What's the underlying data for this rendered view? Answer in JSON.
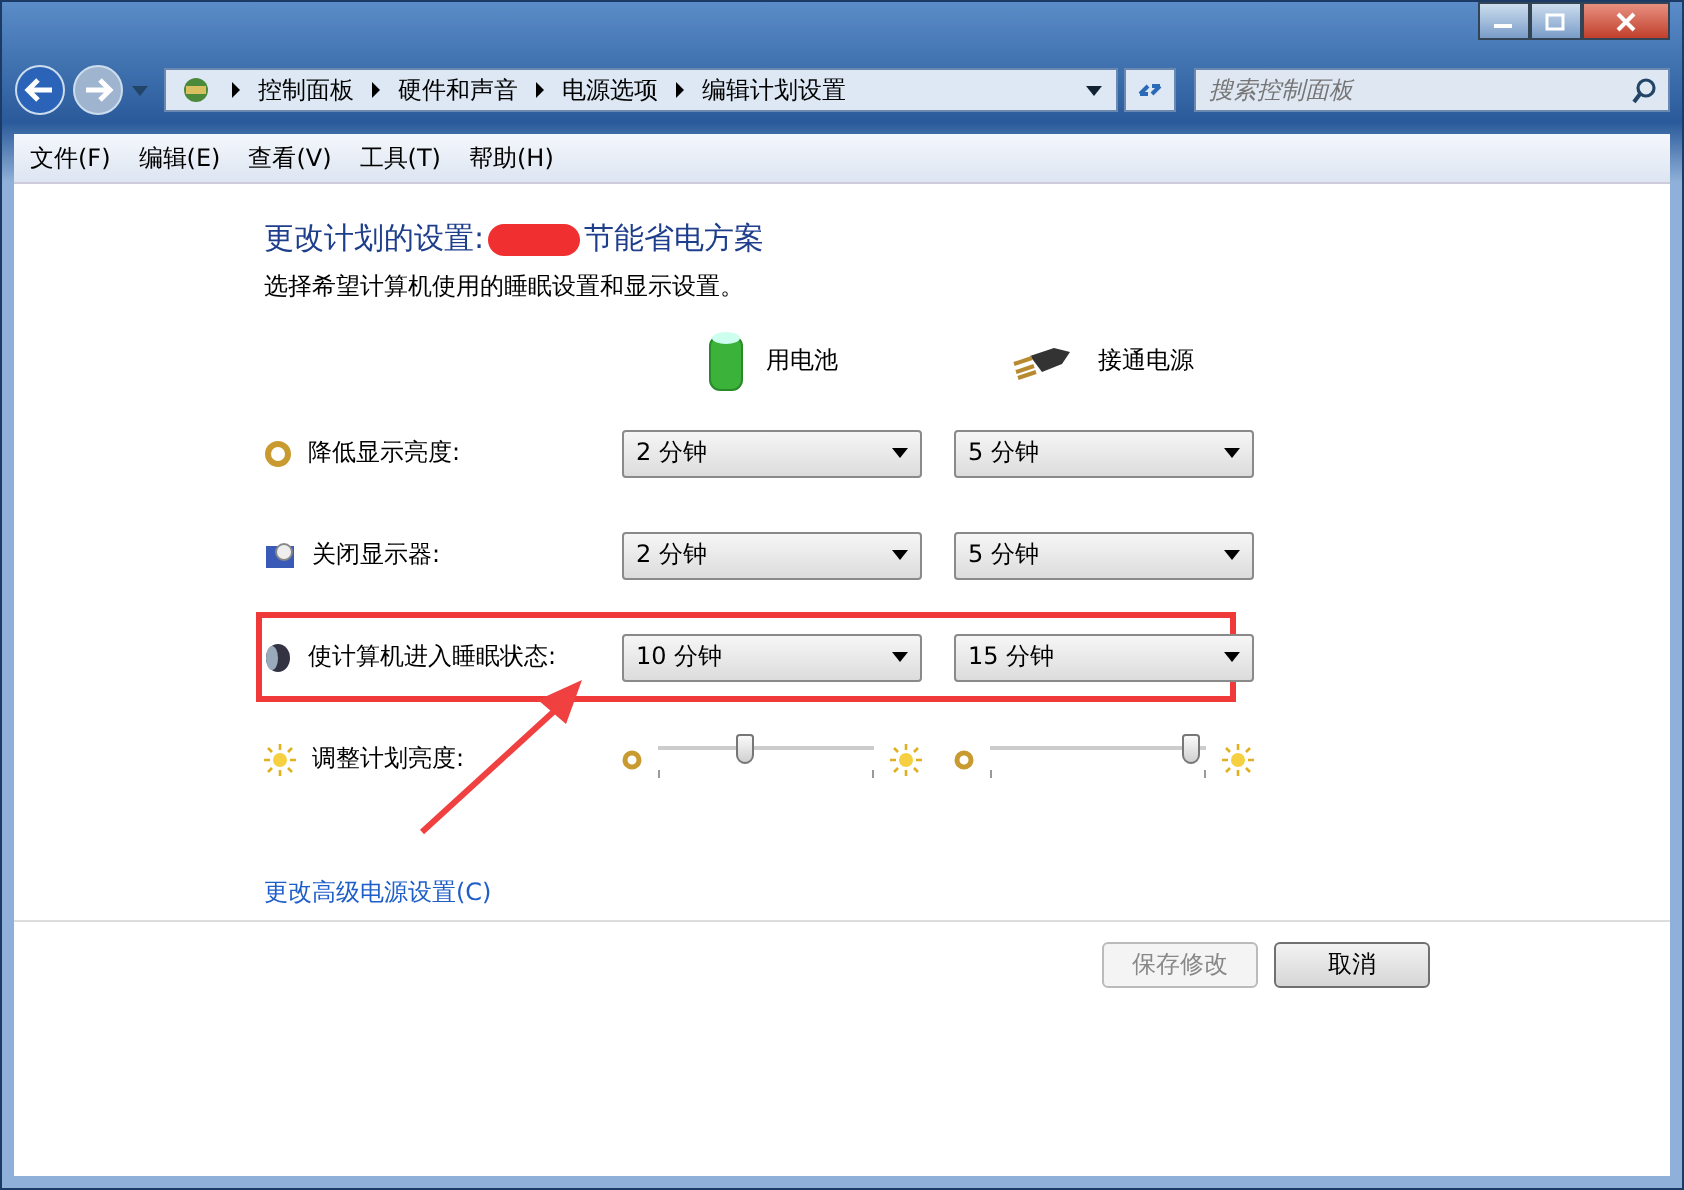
{
  "nav": {
    "breadcrumb": [
      "控制面板",
      "硬件和声音",
      "电源选项",
      "编辑计划设置"
    ],
    "search": {
      "placeholder": "搜索控制面板"
    }
  },
  "menu": [
    "文件(F)",
    "编辑(E)",
    "查看(V)",
    "工具(T)",
    "帮助(H)"
  ],
  "heading": {
    "prefix": "更改计划的设置:",
    "suffix": "节能省电方案"
  },
  "subtitle": "选择希望计算机使用的睡眠设置和显示设置。",
  "columns": [
    {
      "kind": "battery",
      "label": "用电池"
    },
    {
      "kind": "plug",
      "label": "接通电源"
    }
  ],
  "rows": [
    {
      "kind": "select",
      "label": "降低显示亮度:",
      "highlighted": false,
      "values": [
        "2 分钟",
        "5 分钟"
      ]
    },
    {
      "kind": "select",
      "label": "关闭显示器:",
      "highlighted": false,
      "values": [
        "2 分钟",
        "5 分钟"
      ]
    },
    {
      "kind": "select",
      "label": "使计算机进入睡眠状态:",
      "highlighted": true,
      "values": [
        "10 分钟",
        "15 分钟"
      ]
    },
    {
      "kind": "slider",
      "label": "调整计划亮度:",
      "highlighted": false,
      "sliders": [
        {
          "level": 0.4
        },
        {
          "level": 0.93
        }
      ]
    }
  ],
  "link": "更改高级电源设置(C)",
  "buttons": [
    {
      "label": "保存修改",
      "disabled": true
    },
    {
      "label": "取消",
      "disabled": false
    }
  ]
}
